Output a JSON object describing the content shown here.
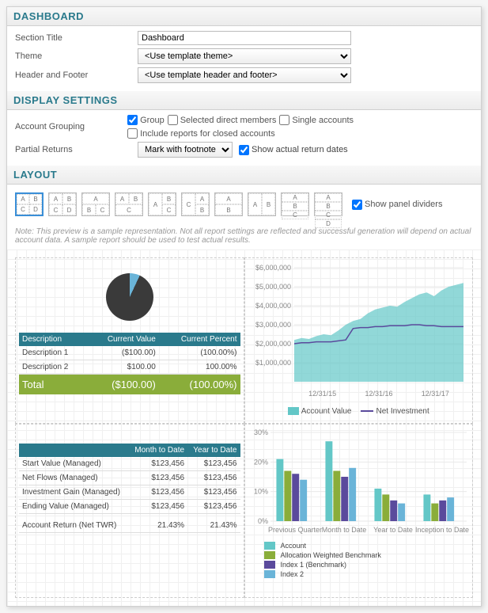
{
  "dashboard": {
    "title": "DASHBOARD",
    "section_title_label": "Section Title",
    "section_title_value": "Dashboard",
    "theme_label": "Theme",
    "theme_value": "<Use template theme>",
    "header_footer_label": "Header and Footer",
    "header_footer_value": "<Use template header and footer>"
  },
  "display": {
    "title": "DISPLAY SETTINGS",
    "account_grouping_label": "Account Grouping",
    "group": "Group",
    "selected_direct": "Selected direct members",
    "single": "Single accounts",
    "include_closed": "Include reports for closed accounts",
    "partial_returns_label": "Partial Returns",
    "partial_returns_value": "Mark with footnote",
    "show_actual": "Show actual return dates"
  },
  "layout": {
    "title": "LAYOUT",
    "show_dividers": "Show panel dividers",
    "note": "Note: This preview is a sample representation. Not all report settings are reflected and successful generation will depend on actual account data. A sample report should be used to test actual results."
  },
  "preview": {
    "desc_table": {
      "headers": [
        "Description",
        "Current Value",
        "Current Percent"
      ],
      "rows": [
        {
          "desc": "Description 1",
          "value": "($100.00)",
          "pct": "(100.00%)"
        },
        {
          "desc": "Description 2",
          "value": "$100.00",
          "pct": "100.00%"
        }
      ],
      "total_label": "Total",
      "total_value": "($100.00)",
      "total_pct": "(100.00%)"
    },
    "area_chart_legend": {
      "series1": "Account Value",
      "series2": "Net Investment"
    },
    "perf_table": {
      "headers": [
        "",
        "Month to Date",
        "Year to Date"
      ],
      "rows": [
        {
          "label": "Start Value (Managed)",
          "mtd": "$123,456",
          "ytd": "$123,456"
        },
        {
          "label": "Net Flows (Managed)",
          "mtd": "$123,456",
          "ytd": "$123,456"
        },
        {
          "label": "Investment Gain (Managed)",
          "mtd": "$123,456",
          "ytd": "$123,456"
        },
        {
          "label": "Ending Value (Managed)",
          "mtd": "$123,456",
          "ytd": "$123,456"
        },
        {
          "label": "Account Return (Net TWR)",
          "mtd": "21.43%",
          "ytd": "21.43%"
        }
      ]
    },
    "bar_legend": [
      "Account",
      "Allocation Weighted Benchmark",
      "Index 1 (Benchmark)",
      "Index 2"
    ]
  },
  "chart_data": [
    {
      "type": "pie",
      "values": [
        7,
        93
      ],
      "colors": [
        "#6ab4d8",
        "#3a3a3a"
      ]
    },
    {
      "type": "area",
      "title": "",
      "ylabel": "",
      "ylim": [
        0,
        6000000
      ],
      "yticks": [
        "$1,000,000",
        "$2,000,000",
        "$3,000,000",
        "$4,000,000",
        "$5,000,000",
        "$6,000,000"
      ],
      "xticks": [
        "12/31/15",
        "12/31/16",
        "12/31/17"
      ],
      "series": [
        {
          "name": "Account Value",
          "color": "#63c7c7",
          "values": [
            2200000,
            2300000,
            2250000,
            2400000,
            2500000,
            2450000,
            2700000,
            3000000,
            3200000,
            3300000,
            3600000,
            3800000,
            3900000,
            4000000,
            3950000,
            4200000,
            4400000,
            4600000,
            4700000,
            4500000,
            4800000,
            5000000,
            5100000,
            5200000
          ]
        },
        {
          "name": "Net Investment",
          "color": "#5a4a9c",
          "values": [
            2000000,
            2050000,
            2050000,
            2100000,
            2100000,
            2100000,
            2150000,
            2200000,
            2800000,
            2850000,
            2850000,
            2900000,
            2900000,
            2950000,
            2950000,
            2950000,
            3000000,
            3000000,
            2950000,
            2950000,
            2900000,
            2900000,
            2900000,
            2900000
          ]
        }
      ]
    },
    {
      "type": "bar",
      "ylabel": "",
      "ylim": [
        0,
        30
      ],
      "yticks": [
        "0%",
        "10%",
        "20%",
        "30%"
      ],
      "categories": [
        "Previous Quarter",
        "Month to Date",
        "Year to Date",
        "Inception to Date"
      ],
      "series": [
        {
          "name": "Account",
          "color": "#63c7c7",
          "values": [
            21,
            27,
            11,
            9
          ]
        },
        {
          "name": "Allocation Weighted Benchmark",
          "color": "#8aad3a",
          "values": [
            17,
            17,
            9,
            6
          ]
        },
        {
          "name": "Index 1 (Benchmark)",
          "color": "#5a4a9c",
          "values": [
            16,
            15,
            7,
            7
          ]
        },
        {
          "name": "Index 2",
          "color": "#6ab4d8",
          "values": [
            14,
            18,
            6,
            8
          ]
        }
      ]
    }
  ]
}
